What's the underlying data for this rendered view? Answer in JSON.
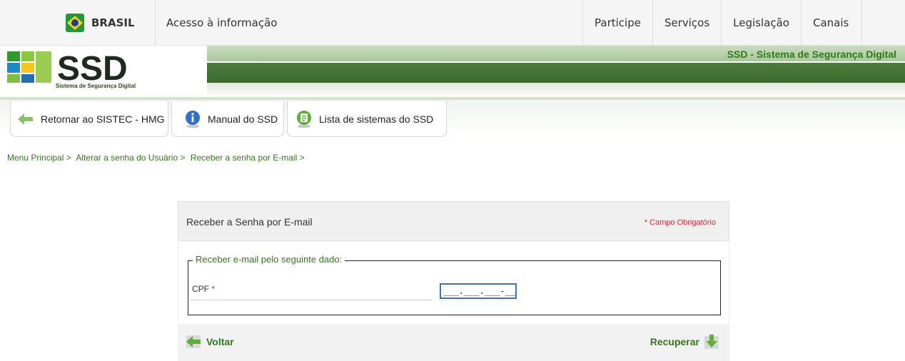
{
  "govbar": {
    "brasil": "BRASIL",
    "acesso": "Acesso à informação",
    "links": [
      "Participe",
      "Serviços",
      "Legislação",
      "Canais"
    ]
  },
  "header": {
    "title": "SSD - Sistema de Segurança Digital",
    "logo_text": "SSD",
    "logo_subtitle": "Sistema de Segurança Digital"
  },
  "menu": {
    "items": [
      {
        "label": "Retornar ao SISTEC - HMG",
        "icon": "arrow-left-icon"
      },
      {
        "label": "Manual do SSD",
        "icon": "info-icon"
      },
      {
        "label": "Lista de sistemas do SSD",
        "icon": "list-icon"
      }
    ]
  },
  "breadcrumb": [
    "Menu Principal >",
    "Alterar a senha do Usuário >",
    "Receber a senha por E-mail >"
  ],
  "form": {
    "title": "Receber a Senha por E-mail",
    "required_note": "* Campo Obrigatório",
    "legend": "Receber e-mail pelo seguinte dado:",
    "cpf_label": "CPF",
    "cpf_required": "*",
    "cpf_value": "___.___.___-__",
    "back_label": "Voltar",
    "submit_label": "Recuperar"
  },
  "colors": {
    "accent_green": "#2f7a16",
    "dark_green_band": "#3b6a2d",
    "required_red": "#e8232e"
  }
}
